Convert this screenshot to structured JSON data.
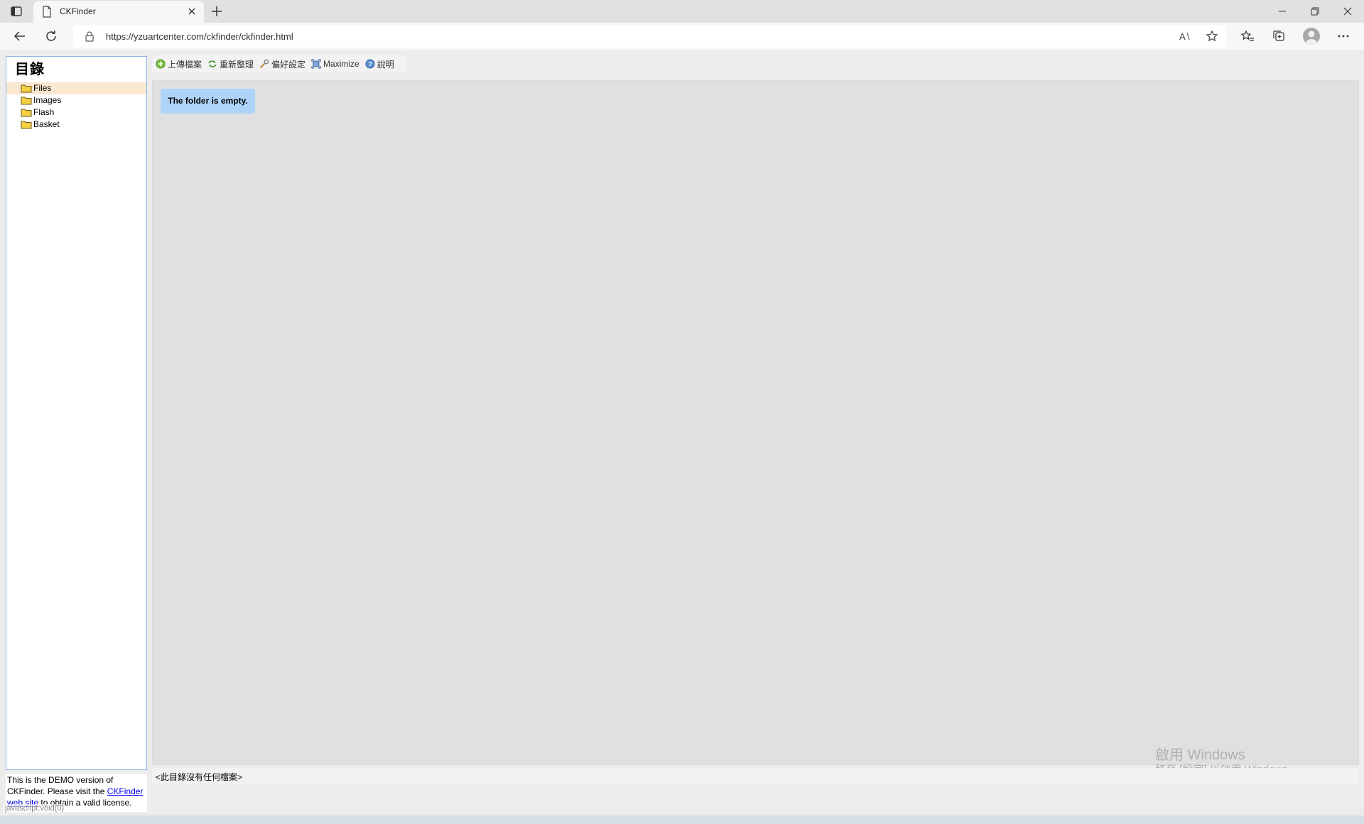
{
  "browser": {
    "tab_title": "CKFinder",
    "url": "https://yzuartcenter.com/ckfinder/ckfinder.html"
  },
  "folders": {
    "title": "目錄",
    "items": [
      {
        "label": "Files",
        "selected": true
      },
      {
        "label": "Images",
        "selected": false
      },
      {
        "label": "Flash",
        "selected": false
      },
      {
        "label": "Basket",
        "selected": false
      }
    ]
  },
  "toolbar": {
    "upload": "上傳檔案",
    "refresh": "重新整理",
    "settings": "偏好設定",
    "maximize": "Maximize",
    "help": "說明"
  },
  "files": {
    "empty_message": "The folder is empty."
  },
  "status_bar": {
    "text": "<此目錄沒有任何檔案>"
  },
  "demo": {
    "text_before": "This is the DEMO version of CKFinder. Please visit the ",
    "link_text": "CKFinder web site",
    "text_after": " to obtain a valid license."
  },
  "hover_status": "javascript:void(0)",
  "windows_watermark": {
    "title": "啟用 Windows",
    "subtitle": "移至 [設定] 以啟用 Windows。"
  },
  "colors": {
    "selected_folder": "#fbe8d0",
    "empty_message_bg": "#aed5f9",
    "panel_border": "#8fb6e6",
    "folder_icon": "#f5d142"
  }
}
